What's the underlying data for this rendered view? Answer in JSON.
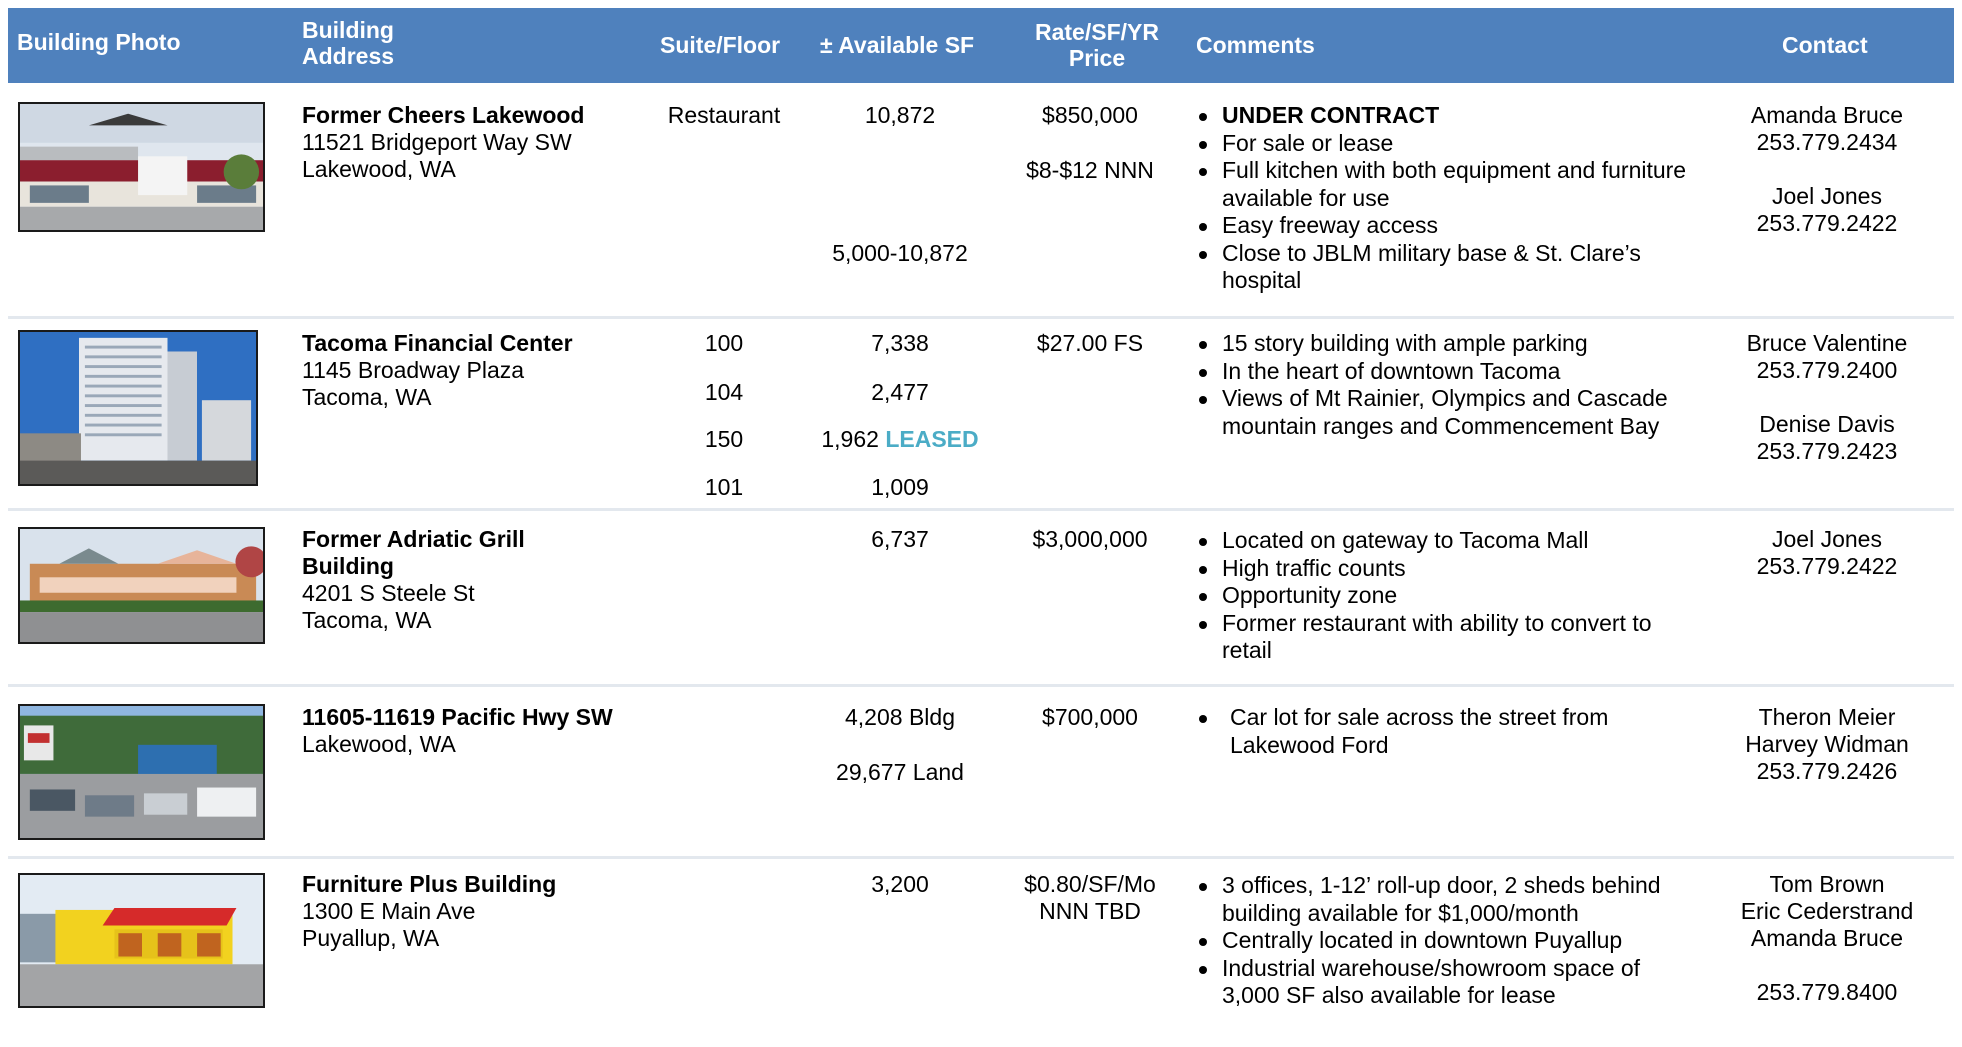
{
  "header": {
    "photo": "Building Photo",
    "address": "Building\nAddress",
    "suite": "Suite/Floor",
    "sf": "± Available SF",
    "rate": "Rate/SF/YR\nPrice",
    "comments": "Comments",
    "contact": "Contact"
  },
  "colors": {
    "header_bg": "#4f81bd",
    "leased": "#4bacc6"
  },
  "rows": [
    {
      "name": "Former Cheers Lakewood",
      "street": "11521 Bridgeport Way SW",
      "city": "Lakewood, WA",
      "suite": [
        "Restaurant"
      ],
      "sf": [
        "10,872",
        "5,000-10,872"
      ],
      "rate": [
        "$850,000",
        "$8-$12 NNN"
      ],
      "comments": [
        "UNDER CONTRACT",
        "For sale or lease",
        "Full kitchen with both equipment and furniture available for use",
        "Easy freeway access",
        "Close to JBLM military base & St. Clare’s hospital"
      ],
      "contact": [
        "Amanda Bruce",
        "253.779.2434",
        "Joel Jones",
        "253.779.2422"
      ]
    },
    {
      "name": "Tacoma Financial Center",
      "street": "1145 Broadway Plaza",
      "city": "Tacoma, WA",
      "suite": [
        "100",
        "104",
        "150",
        "101"
      ],
      "sf": [
        "7,338",
        "2,477",
        "1,962",
        "1,009"
      ],
      "sf_status": "LEASED",
      "rate": [
        "$27.00 FS"
      ],
      "comments": [
        "15 story building with ample parking",
        "In the heart of downtown Tacoma",
        "Views of Mt Rainier, Olympics and Cascade mountain ranges and Commencement Bay"
      ],
      "contact": [
        "Bruce Valentine",
        "253.779.2400",
        "Denise Davis",
        "253.779.2423"
      ]
    },
    {
      "name": "Former Adriatic Grill Building",
      "street": "4201 S Steele St",
      "city": "Tacoma, WA",
      "sf": [
        "6,737"
      ],
      "rate": [
        "$3,000,000"
      ],
      "comments": [
        "Located on gateway to Tacoma Mall",
        "High traffic counts",
        "Opportunity zone",
        "Former restaurant with ability to convert to retail"
      ],
      "contact": [
        "Joel Jones",
        "253.779.2422"
      ]
    },
    {
      "name": "11605-11619 Pacific Hwy SW",
      "city": "Lakewood, WA",
      "sf": [
        "4,208 Bldg",
        "29,677 Land"
      ],
      "rate": [
        "$700,000"
      ],
      "comments": [
        "Car lot for sale across the street from Lakewood Ford"
      ],
      "contact": [
        "Theron Meier",
        "Harvey Widman",
        "253.779.2426"
      ]
    },
    {
      "name": "Furniture Plus Building",
      "street": "1300 E Main Ave",
      "city": "Puyallup, WA",
      "sf": [
        "3,200"
      ],
      "rate": [
        "$0.80/SF/Mo",
        "NNN TBD"
      ],
      "comments": [
        "3 offices, 1-12’ roll-up door, 2 sheds behind building available for $1,000/month",
        "Centrally located in downtown Puyallup",
        "Industrial warehouse/showroom space of 3,000 SF also available for lease"
      ],
      "contact": [
        "Tom Brown",
        "Eric Cederstrand",
        "Amanda Bruce",
        "253.779.8400"
      ]
    }
  ]
}
